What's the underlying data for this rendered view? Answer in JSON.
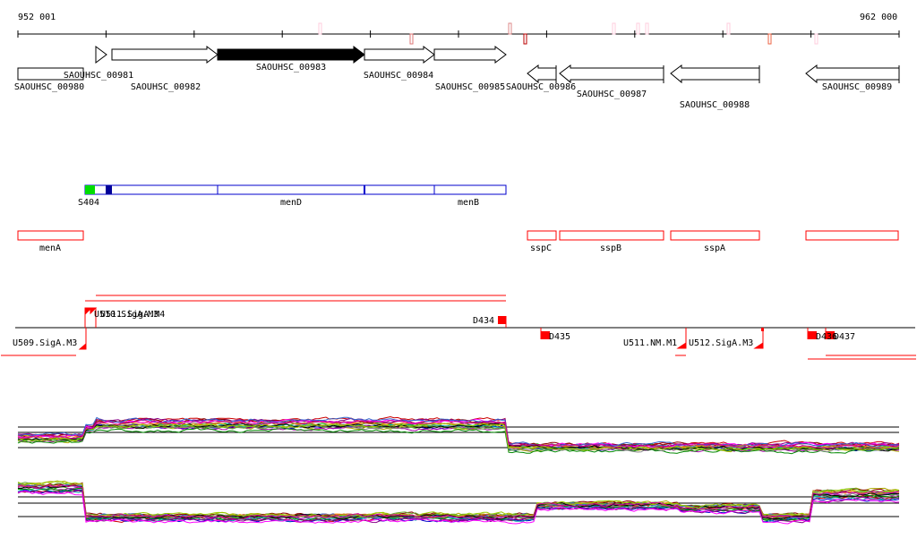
{
  "coords": {
    "start": "952 001",
    "end": "962 000"
  },
  "genes": [
    {
      "id": "SAOUHSC_00980",
      "strand": "box"
    },
    {
      "id": "SAOUHSC_00981",
      "strand": "+"
    },
    {
      "id": "SAOUHSC_00982",
      "strand": "+"
    },
    {
      "id": "SAOUHSC_00983",
      "strand": "+",
      "selected": true
    },
    {
      "id": "SAOUHSC_00984",
      "strand": "+"
    },
    {
      "id": "SAOUHSC_00985",
      "strand": "+"
    },
    {
      "id": "SAOUHSC_00986",
      "strand": "-"
    },
    {
      "id": "SAOUHSC_00987",
      "strand": "-"
    },
    {
      "id": "SAOUHSC_00988",
      "strand": "-"
    },
    {
      "id": "SAOUHSC_00989",
      "strand": "-"
    }
  ],
  "operon": {
    "labels": [
      "S404",
      "menD",
      "menB"
    ]
  },
  "gene_names": [
    "menA",
    "sspC",
    "sspB",
    "sspA",
    ""
  ],
  "features": {
    "upper": [
      "U510.SigA.M3",
      "U511.SigA.M4",
      "D434"
    ],
    "lower": [
      "U509.SigA.M3",
      "D435",
      "U511.NM.M1",
      "U512.SigA.M3",
      "D436",
      "D437"
    ]
  },
  "colors": {
    "red": "#ff0000",
    "operon": "#0000cc",
    "start": "#00dd00",
    "selected_gene": "#000000"
  }
}
